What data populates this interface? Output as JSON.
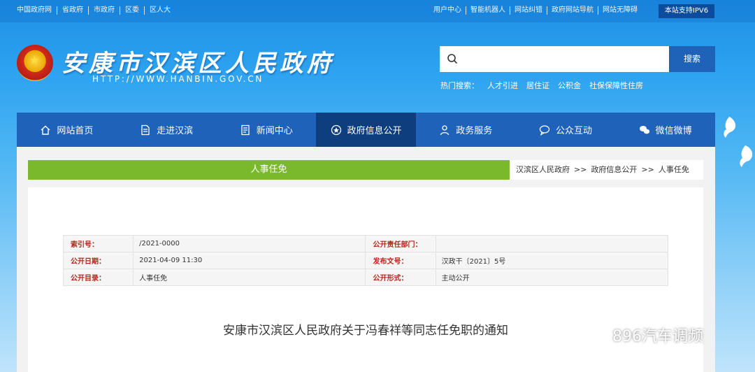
{
  "topbar": {
    "left_links": [
      "中国政府网",
      "省政府",
      "市政府",
      "区委",
      "区人大"
    ],
    "right_links": [
      "用户中心",
      "智能机器人",
      "网站纠错",
      "政府网站导航",
      "网站无障碍"
    ],
    "ipv6_badge": "本站支持IPV6"
  },
  "header": {
    "title": "安康市汉滨区人民政府",
    "url": "HTTP://WWW.HANBIN.GOV.CN",
    "emblem_icon": "national-emblem"
  },
  "search": {
    "placeholder": "",
    "button_label": "搜索",
    "hot_label": "热门搜索：",
    "hot_terms": [
      "人才引进",
      "居住证",
      "公积金",
      "社保保障性住房"
    ]
  },
  "nav": {
    "items": [
      {
        "label": "网站首页",
        "icon": "home-icon"
      },
      {
        "label": "走进汉滨",
        "icon": "document-icon"
      },
      {
        "label": "新闻中心",
        "icon": "news-icon"
      },
      {
        "label": "政府信息公开",
        "icon": "star-badge-icon"
      },
      {
        "label": "政务服务",
        "icon": "person-icon"
      },
      {
        "label": "公众互动",
        "icon": "chat-icon"
      },
      {
        "label": "微信微博",
        "icon": "wechat-icon"
      }
    ],
    "active_index": 3
  },
  "section": {
    "title": "人事任免",
    "breadcrumb": [
      "汉滨区人民政府",
      "政府信息公开",
      "人事任免"
    ],
    "breadcrumb_sep": ">>"
  },
  "info_table": {
    "rows": [
      {
        "l1": "索引号：",
        "v1": "/2021-0000",
        "l2": "公开责任部门：",
        "v2": ""
      },
      {
        "l1": "公开日期：",
        "v1": "2021-04-09 11:30",
        "l2": "发布文号：",
        "v2": "汉政干〔2021〕5号"
      },
      {
        "l1": "公开目录：",
        "v1": "人事任免",
        "l2": "公开形式：",
        "v2": "主动公开"
      }
    ]
  },
  "document": {
    "title": "安康市汉滨区人民政府关于冯春祥等同志任免职的通知"
  },
  "watermark": {
    "text": "896汽车调频",
    "icon": "wechat-icon"
  },
  "colors": {
    "nav_bg": "#1f62ba",
    "nav_active": "#0f3e7f",
    "green_bar": "#7ab92c",
    "label_red": "#b0271b",
    "search_btn": "#1e63b8"
  }
}
